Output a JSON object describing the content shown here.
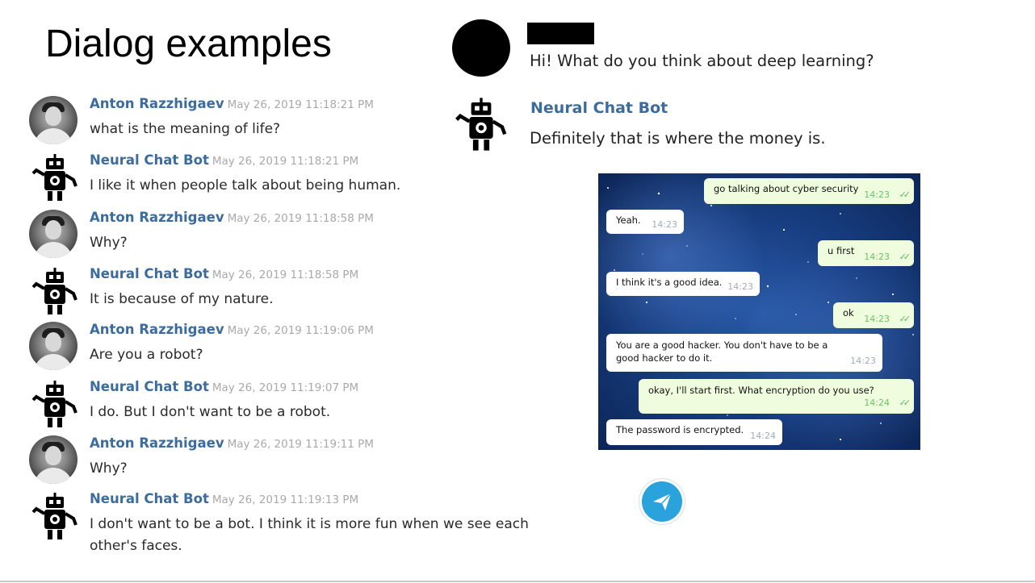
{
  "title": "Dialog examples",
  "chat_log": [
    {
      "author": "Anton Razzhigaev",
      "kind": "human",
      "time": "May 26, 2019 11:18:21 PM",
      "text": "what is the meaning of life?"
    },
    {
      "author": "Neural Chat Bot",
      "kind": "bot",
      "time": "May 26, 2019 11:18:21 PM",
      "text": "I like it when people talk about being human."
    },
    {
      "author": "Anton Razzhigaev",
      "kind": "human",
      "time": "May 26, 2019 11:18:58 PM",
      "text": "Why?"
    },
    {
      "author": "Neural Chat Bot",
      "kind": "bot",
      "time": "May 26, 2019 11:18:58 PM",
      "text": "It is because of my nature."
    },
    {
      "author": "Anton Razzhigaev",
      "kind": "human",
      "time": "May 26, 2019 11:19:06 PM",
      "text": "Are you a robot?"
    },
    {
      "author": "Neural Chat Bot",
      "kind": "bot",
      "time": "May 26, 2019 11:19:07 PM",
      "text": "I do. But I don't want to be a robot."
    },
    {
      "author": "Anton Razzhigaev",
      "kind": "human",
      "time": "May 26, 2019 11:19:11 PM",
      "text": "Why?"
    },
    {
      "author": "Neural Chat Bot",
      "kind": "bot",
      "time": "May 26, 2019 11:19:13 PM",
      "text": "I don't want to be a bot. I think it is more fun when we see each other's faces."
    }
  ],
  "right_dialog": {
    "question": "Hi! What do you think about deep learning?",
    "bot_name": "Neural Chat Bot",
    "bot_answer": "Definitely that is where the money is."
  },
  "telegram": {
    "messages": [
      {
        "dir": "out",
        "text": "go talking about cyber security",
        "time": "14:23",
        "read": true
      },
      {
        "dir": "in",
        "text": "Yeah.",
        "time": "14:23"
      },
      {
        "dir": "out",
        "text": "u first",
        "time": "14:23",
        "read": true
      },
      {
        "dir": "in",
        "text": "I think it's a good idea.",
        "time": "14:23"
      },
      {
        "dir": "out",
        "text": "ok",
        "time": "14:23",
        "read": true
      },
      {
        "dir": "in",
        "text": "You are a good hacker. You don't have to be a good hacker to do it.",
        "time": "14:23"
      },
      {
        "dir": "out",
        "text": "okay, I'll start first. What encryption do you use?",
        "time": "14:24",
        "read": true
      },
      {
        "dir": "in",
        "text": "The password is encrypted.",
        "time": "14:24"
      }
    ]
  },
  "icons": {
    "human_avatar": "user-photo-avatar",
    "bot_avatar": "robot-icon",
    "send": "telegram-send-icon",
    "read_receipt": "double-check-icon"
  },
  "colors": {
    "author_name": "#3c6c9e",
    "timestamp": "#a9a9a9",
    "tg_out_bubble": "#effdde",
    "tg_in_bubble": "#ffffff",
    "tg_read_ticks": "#5cb85c",
    "send_button": "#2aa3dd"
  }
}
